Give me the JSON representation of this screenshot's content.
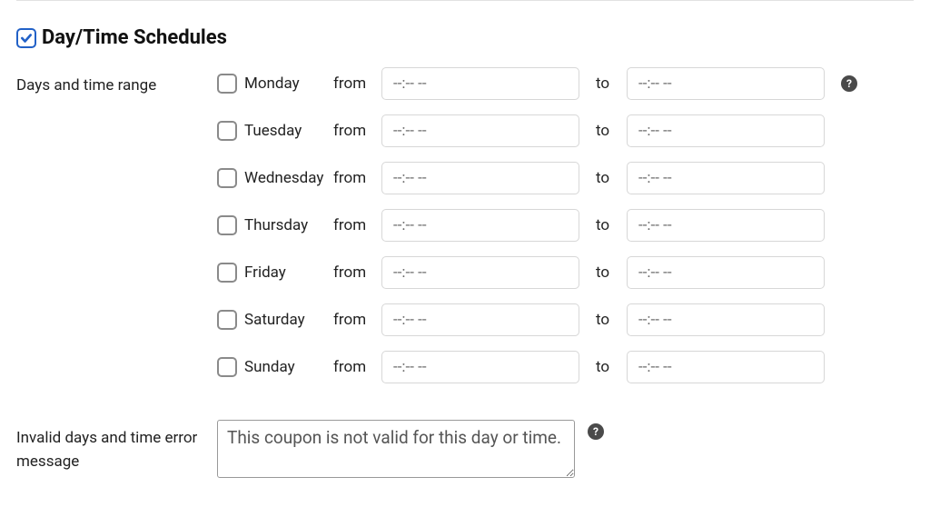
{
  "section": {
    "title": "Day/Time Schedules",
    "checked": true
  },
  "labels": {
    "days_range": "Days and time range",
    "from": "from",
    "to": "to",
    "invalid_error": "Invalid days and time error message"
  },
  "placeholders": {
    "time": "--:-- --"
  },
  "days": [
    {
      "name": "Monday",
      "checked": false,
      "from": "",
      "to": ""
    },
    {
      "name": "Tuesday",
      "checked": false,
      "from": "",
      "to": ""
    },
    {
      "name": "Wednesday",
      "checked": false,
      "from": "",
      "to": ""
    },
    {
      "name": "Thursday",
      "checked": false,
      "from": "",
      "to": ""
    },
    {
      "name": "Friday",
      "checked": false,
      "from": "",
      "to": ""
    },
    {
      "name": "Saturday",
      "checked": false,
      "from": "",
      "to": ""
    },
    {
      "name": "Sunday",
      "checked": false,
      "from": "",
      "to": ""
    }
  ],
  "error_message": {
    "value": "This coupon is not valid for this day or time."
  },
  "help_glyph": "?"
}
